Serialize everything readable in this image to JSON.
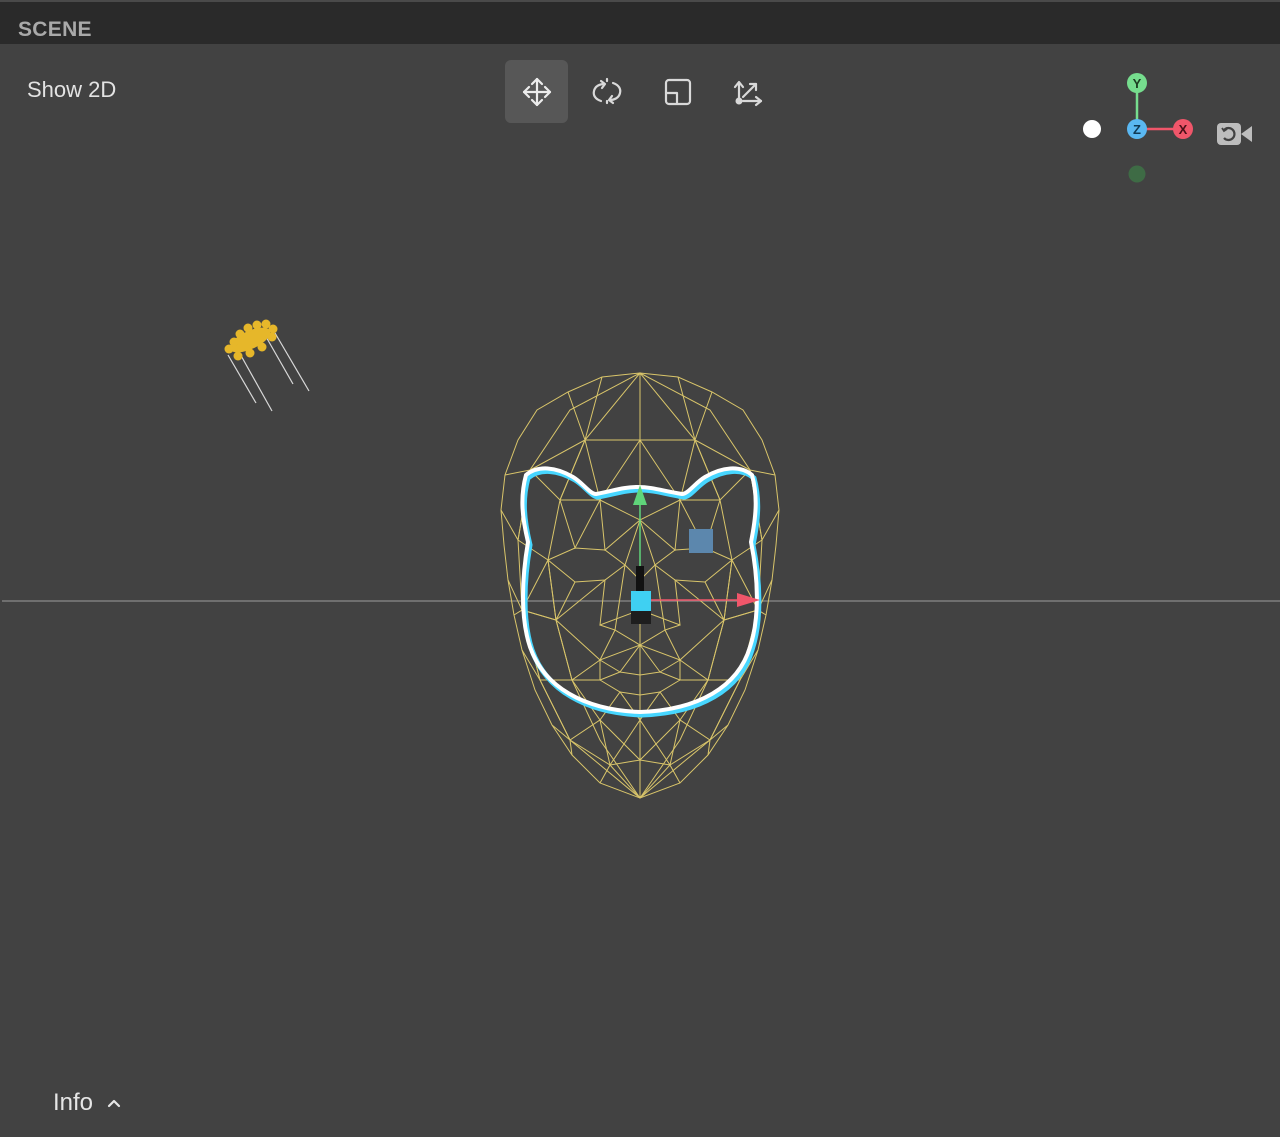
{
  "panel": {
    "title": "SCENE"
  },
  "viewport": {
    "show_2d_label": "Show 2D",
    "info_label": "Info",
    "tools": [
      {
        "name": "move-tool",
        "icon": "move-arrows-icon",
        "active": true
      },
      {
        "name": "rotate-tool",
        "icon": "rotate-icon",
        "active": false
      },
      {
        "name": "scale-tool",
        "icon": "scale-icon",
        "active": false
      },
      {
        "name": "pivot-tool",
        "icon": "pivot-icon",
        "active": false
      }
    ],
    "axis_gizmo": {
      "y_label": "Y",
      "z_label": "Z",
      "x_label": "X",
      "colors": {
        "x": "#f0566a",
        "y": "#76dd8e",
        "z": "#5ab8f2"
      },
      "camera_icon": "camera-switch-icon"
    }
  },
  "colors": {
    "mesh": "#d9c56a",
    "outline_white": "#ffffff",
    "outline_cyan": "#47d6ff",
    "light_gold": "#e6b72a"
  }
}
